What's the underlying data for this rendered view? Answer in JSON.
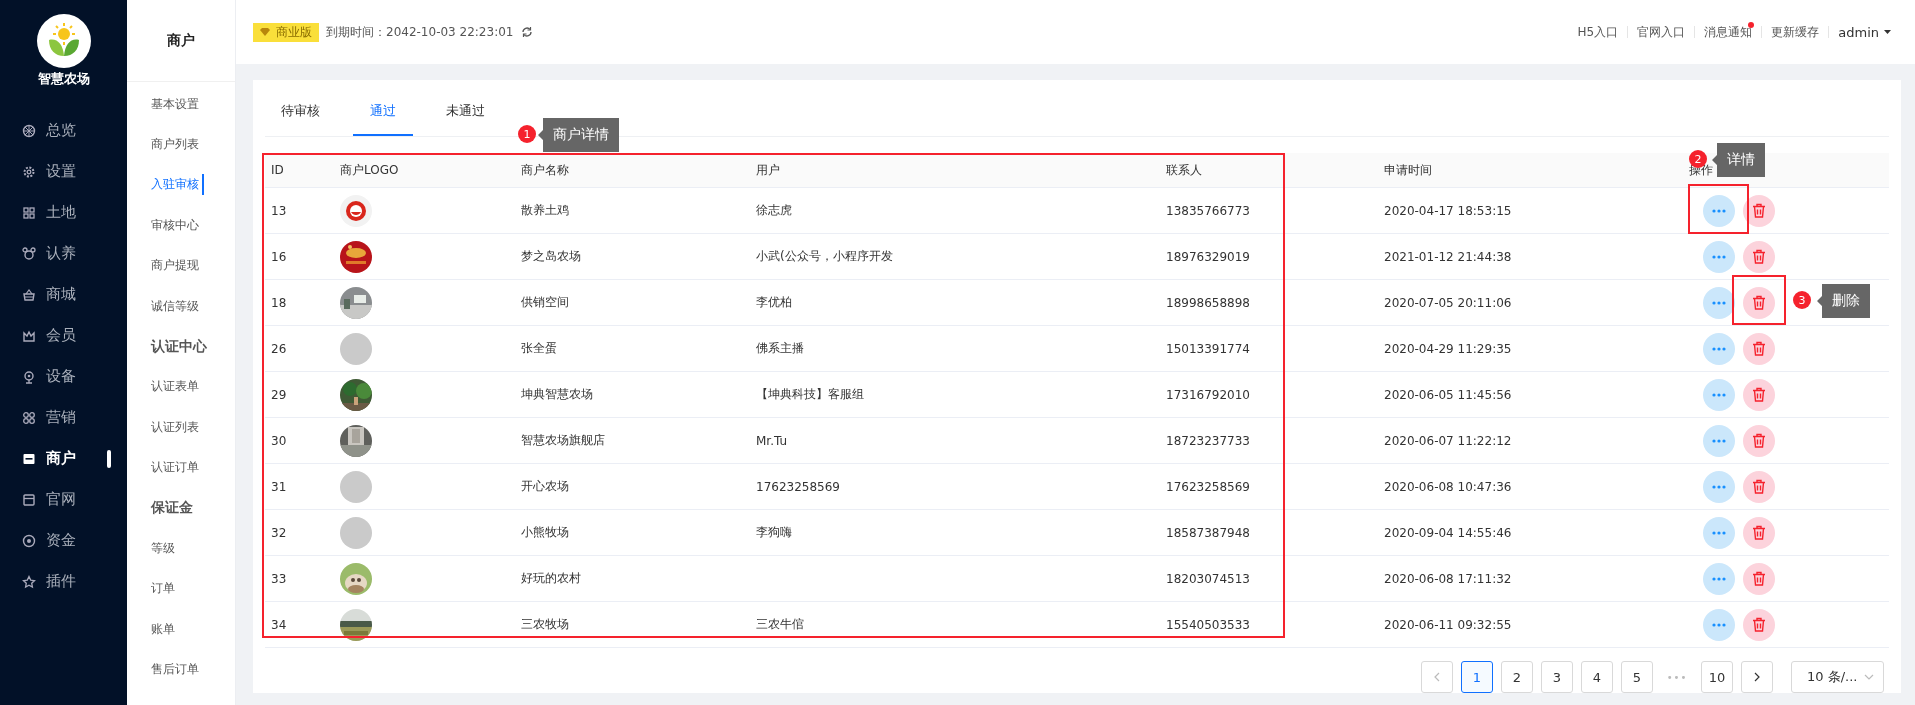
{
  "sidebar": {
    "logo_text": "智慧农场",
    "items": [
      {
        "label": "总览",
        "selected": false
      },
      {
        "label": "设置",
        "selected": false
      },
      {
        "label": "土地",
        "selected": false
      },
      {
        "label": "认养",
        "selected": false
      },
      {
        "label": "商城",
        "selected": false
      },
      {
        "label": "会员",
        "selected": false
      },
      {
        "label": "设备",
        "selected": false
      },
      {
        "label": "营销",
        "selected": false
      },
      {
        "label": "商户",
        "selected": true
      },
      {
        "label": "官网",
        "selected": false
      },
      {
        "label": "资金",
        "selected": false
      },
      {
        "label": "插件",
        "selected": false
      }
    ]
  },
  "submenu": {
    "title": "商户",
    "items": [
      {
        "label": "基本设置",
        "kind": "link",
        "selected": false
      },
      {
        "label": "商户列表",
        "kind": "link",
        "selected": false
      },
      {
        "label": "入驻审核",
        "kind": "link",
        "selected": true
      },
      {
        "label": "审核中心",
        "kind": "link",
        "selected": false
      },
      {
        "label": "商户提现",
        "kind": "link",
        "selected": false
      },
      {
        "label": "诚信等级",
        "kind": "link",
        "selected": false
      },
      {
        "label": "认证中心",
        "kind": "group"
      },
      {
        "label": "认证表单",
        "kind": "link",
        "selected": false
      },
      {
        "label": "认证列表",
        "kind": "link",
        "selected": false
      },
      {
        "label": "认证订单",
        "kind": "link",
        "selected": false
      },
      {
        "label": "保证金",
        "kind": "group"
      },
      {
        "label": "等级",
        "kind": "link",
        "selected": false
      },
      {
        "label": "订单",
        "kind": "link",
        "selected": false
      },
      {
        "label": "账单",
        "kind": "link",
        "selected": false
      },
      {
        "label": "售后订单",
        "kind": "link",
        "selected": false
      }
    ]
  },
  "header": {
    "edition": "商业版",
    "expiry": "到期时间：2042-10-03 22:23:01",
    "links": [
      {
        "label": "H5入口",
        "dot": false
      },
      {
        "label": "官网入口",
        "dot": false
      },
      {
        "label": "消息通知",
        "dot": true
      },
      {
        "label": "更新缓存",
        "dot": false
      }
    ],
    "user": "admin"
  },
  "tabs": [
    {
      "label": "待审核",
      "selected": false
    },
    {
      "label": "通过",
      "selected": true
    },
    {
      "label": "未通过",
      "selected": false
    }
  ],
  "table": {
    "columns": [
      "ID",
      "商户LOGO",
      "商户名称",
      "用户",
      "联系人",
      "申请时间",
      "操作"
    ],
    "rows": [
      {
        "id": "13",
        "has_logo": true,
        "name": "散养土鸡",
        "user": "徐志虎",
        "contact": "13835766773",
        "time": "2020-04-17 18:53:15"
      },
      {
        "id": "16",
        "has_logo": true,
        "name": "梦之岛农场",
        "user": "小武(公众号，小程序开发",
        "contact": "18976329019",
        "time": "2021-01-12 21:44:38"
      },
      {
        "id": "18",
        "has_logo": true,
        "name": "供销空间",
        "user": "李优柏",
        "contact": "18998658898",
        "time": "2020-07-05 20:11:06"
      },
      {
        "id": "26",
        "has_logo": false,
        "name": "张全蛋",
        "user": "佛系主播",
        "contact": "15013391774",
        "time": "2020-04-29 11:29:35"
      },
      {
        "id": "29",
        "has_logo": true,
        "name": "坤典智慧农场",
        "user": "【坤典科技】客服组",
        "contact": "17316792010",
        "time": "2020-06-05 11:45:56"
      },
      {
        "id": "30",
        "has_logo": true,
        "name": "智慧农场旗舰店",
        "user": "Mr.Tu",
        "contact": "18723237733",
        "time": "2020-06-07 11:22:12"
      },
      {
        "id": "31",
        "has_logo": false,
        "name": "开心农场",
        "user": "17623258569",
        "contact": "17623258569",
        "time": "2020-06-08 10:47:36"
      },
      {
        "id": "32",
        "has_logo": false,
        "name": "小熊牧场",
        "user": "李狗嗨",
        "contact": "18587387948",
        "time": "2020-09-04 14:55:46"
      },
      {
        "id": "33",
        "has_logo": true,
        "name": "好玩的农村",
        "contact": "18203074513",
        "time": "2020-06-08 17:11:32"
      },
      {
        "id": "34",
        "has_logo": true,
        "name": "三农牧场",
        "user": "三农牛倌",
        "contact": "15540503533",
        "time": "2020-06-11 09:32:55"
      }
    ]
  },
  "pagination": {
    "pages": [
      {
        "label": "1",
        "kind": "page",
        "selected": true
      },
      {
        "label": "2",
        "kind": "page",
        "selected": false
      },
      {
        "label": "3",
        "kind": "page",
        "selected": false
      },
      {
        "label": "4",
        "kind": "page",
        "selected": false
      },
      {
        "label": "5",
        "kind": "page",
        "selected": false
      },
      {
        "label": "•••",
        "kind": "ellipsis"
      },
      {
        "label": "10",
        "kind": "page",
        "selected": false
      }
    ],
    "page_size": "10 条/..."
  },
  "annotations": [
    {
      "number": "1",
      "label": "商户详情"
    },
    {
      "number": "2",
      "label": "详情"
    },
    {
      "number": "3",
      "label": "删除"
    }
  ]
}
